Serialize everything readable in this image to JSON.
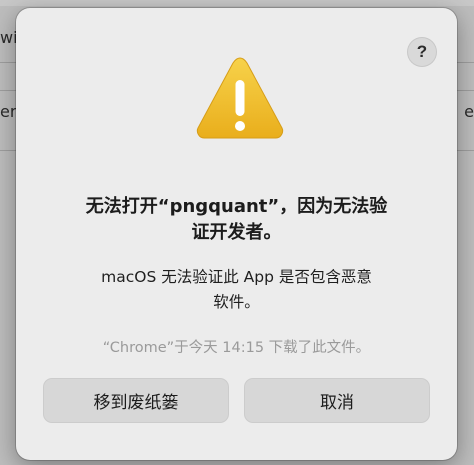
{
  "background": {
    "left_fragment_1": "wit",
    "left_fragment_2": "er",
    "right_fragment": "e"
  },
  "dialog": {
    "help_label": "?",
    "title_line1": "无法打开“pngquant”，因为无法验",
    "title_line2": "证开发者。",
    "message_line1": "macOS 无法验证此 App 是否包含恶意",
    "message_line2": "软件。",
    "source_text": "“Chrome”于今天 14:15 下载了此文件。",
    "buttons": {
      "move_to_trash": "移到废纸篓",
      "cancel": "取消"
    },
    "icon": "warning-triangle-icon",
    "colors": {
      "warning_yellow": "#f2c12e",
      "dialog_bg": "#ececec",
      "button_bg": "#d7d7d7"
    }
  }
}
